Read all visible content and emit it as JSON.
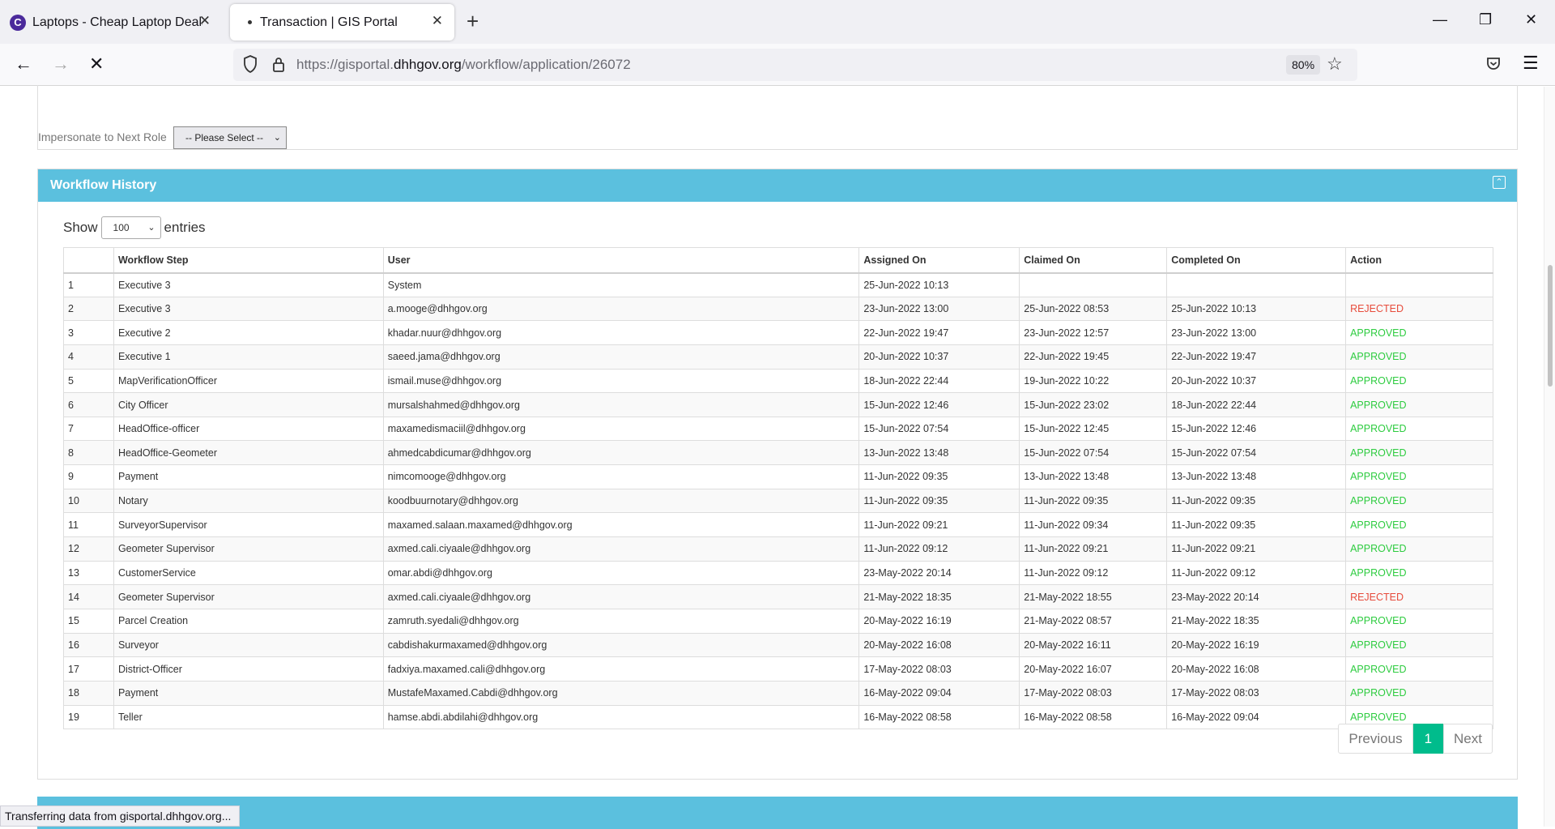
{
  "browser": {
    "tabs": [
      {
        "title": "Laptops - Cheap Laptop Deals | ",
        "favicon": "C",
        "active": false
      },
      {
        "title": "Transaction | GIS Portal",
        "active": true
      }
    ],
    "url_prefix": "https://gisportal.",
    "url_domain": "dhhgov.org",
    "url_path": "/workflow/application/26072",
    "zoom": "80%"
  },
  "page": {
    "impersonate_label": "Impersonate to Next Role",
    "impersonate_value": "-- Please Select --",
    "workflow_title": "Workflow History",
    "show_label": "Show",
    "show_value": "100",
    "entries_label": "entries",
    "columns": [
      "",
      "Workflow Step",
      "User",
      "Assigned On",
      "Claimed On",
      "Completed On",
      "Action"
    ],
    "rows": [
      [
        "1",
        "Executive 3",
        "System",
        "25-Jun-2022 10:13",
        "",
        "",
        ""
      ],
      [
        "2",
        "Executive 3",
        "a.mooge@dhhgov.org",
        "23-Jun-2022 13:00",
        "25-Jun-2022 08:53",
        "25-Jun-2022 10:13",
        "REJECTED"
      ],
      [
        "3",
        "Executive 2",
        "khadar.nuur@dhhgov.org",
        "22-Jun-2022 19:47",
        "23-Jun-2022 12:57",
        "23-Jun-2022 13:00",
        "APPROVED"
      ],
      [
        "4",
        "Executive 1",
        "saeed.jama@dhhgov.org",
        "20-Jun-2022 10:37",
        "22-Jun-2022 19:45",
        "22-Jun-2022 19:47",
        "APPROVED"
      ],
      [
        "5",
        "MapVerificationOfficer",
        "ismail.muse@dhhgov.org",
        "18-Jun-2022 22:44",
        "19-Jun-2022 10:22",
        "20-Jun-2022 10:37",
        "APPROVED"
      ],
      [
        "6",
        "City Officer",
        "mursalshahmed@dhhgov.org",
        "15-Jun-2022 12:46",
        "15-Jun-2022 23:02",
        "18-Jun-2022 22:44",
        "APPROVED"
      ],
      [
        "7",
        "HeadOffice-officer",
        "maxamedismaciil@dhhgov.org",
        "15-Jun-2022 07:54",
        "15-Jun-2022 12:45",
        "15-Jun-2022 12:46",
        "APPROVED"
      ],
      [
        "8",
        "HeadOffice-Geometer",
        "ahmedcabdicumar@dhhgov.org",
        "13-Jun-2022 13:48",
        "15-Jun-2022 07:54",
        "15-Jun-2022 07:54",
        "APPROVED"
      ],
      [
        "9",
        "Payment",
        "nimcomooge@dhhgov.org",
        "11-Jun-2022 09:35",
        "13-Jun-2022 13:48",
        "13-Jun-2022 13:48",
        "APPROVED"
      ],
      [
        "10",
        "Notary",
        "koodbuurnotary@dhhgov.org",
        "11-Jun-2022 09:35",
        "11-Jun-2022 09:35",
        "11-Jun-2022 09:35",
        "APPROVED"
      ],
      [
        "11",
        "SurveyorSupervisor",
        "maxamed.salaan.maxamed@dhhgov.org",
        "11-Jun-2022 09:21",
        "11-Jun-2022 09:34",
        "11-Jun-2022 09:35",
        "APPROVED"
      ],
      [
        "12",
        "Geometer Supervisor",
        "axmed.cali.ciyaale@dhhgov.org",
        "11-Jun-2022 09:12",
        "11-Jun-2022 09:21",
        "11-Jun-2022 09:21",
        "APPROVED"
      ],
      [
        "13",
        "CustomerService",
        "omar.abdi@dhhgov.org",
        "23-May-2022 20:14",
        "11-Jun-2022 09:12",
        "11-Jun-2022 09:12",
        "APPROVED"
      ],
      [
        "14",
        "Geometer Supervisor",
        "axmed.cali.ciyaale@dhhgov.org",
        "21-May-2022 18:35",
        "21-May-2022 18:55",
        "23-May-2022 20:14",
        "REJECTED"
      ],
      [
        "15",
        "Parcel Creation",
        "zamruth.syedali@dhhgov.org",
        "20-May-2022 16:19",
        "21-May-2022 08:57",
        "21-May-2022 18:35",
        "APPROVED"
      ],
      [
        "16",
        "Surveyor",
        "cabdishakurmaxamed@dhhgov.org",
        "20-May-2022 16:08",
        "20-May-2022 16:11",
        "20-May-2022 16:19",
        "APPROVED"
      ],
      [
        "17",
        "District-Officer",
        "fadxiya.maxamed.cali@dhhgov.org",
        "17-May-2022 08:03",
        "20-May-2022 16:07",
        "20-May-2022 16:08",
        "APPROVED"
      ],
      [
        "18",
        "Payment",
        "MustafeMaxamed.Cabdi@dhhgov.org",
        "16-May-2022 09:04",
        "17-May-2022 08:03",
        "17-May-2022 08:03",
        "APPROVED"
      ],
      [
        "19",
        "Teller",
        "hamse.abdi.abdilahi@dhhgov.org",
        "16-May-2022 08:58",
        "16-May-2022 08:58",
        "16-May-2022 09:04",
        "APPROVED"
      ]
    ],
    "pagination": {
      "previous": "Previous",
      "current": "1",
      "next": "Next"
    }
  },
  "status_bar": "Transferring data from gisportal.dhhgov.org...",
  "colors": {
    "panel_header": "#5bc0de",
    "approved": "#2ecc40",
    "rejected": "#e74c3c",
    "page_active": "#00bc8c"
  }
}
